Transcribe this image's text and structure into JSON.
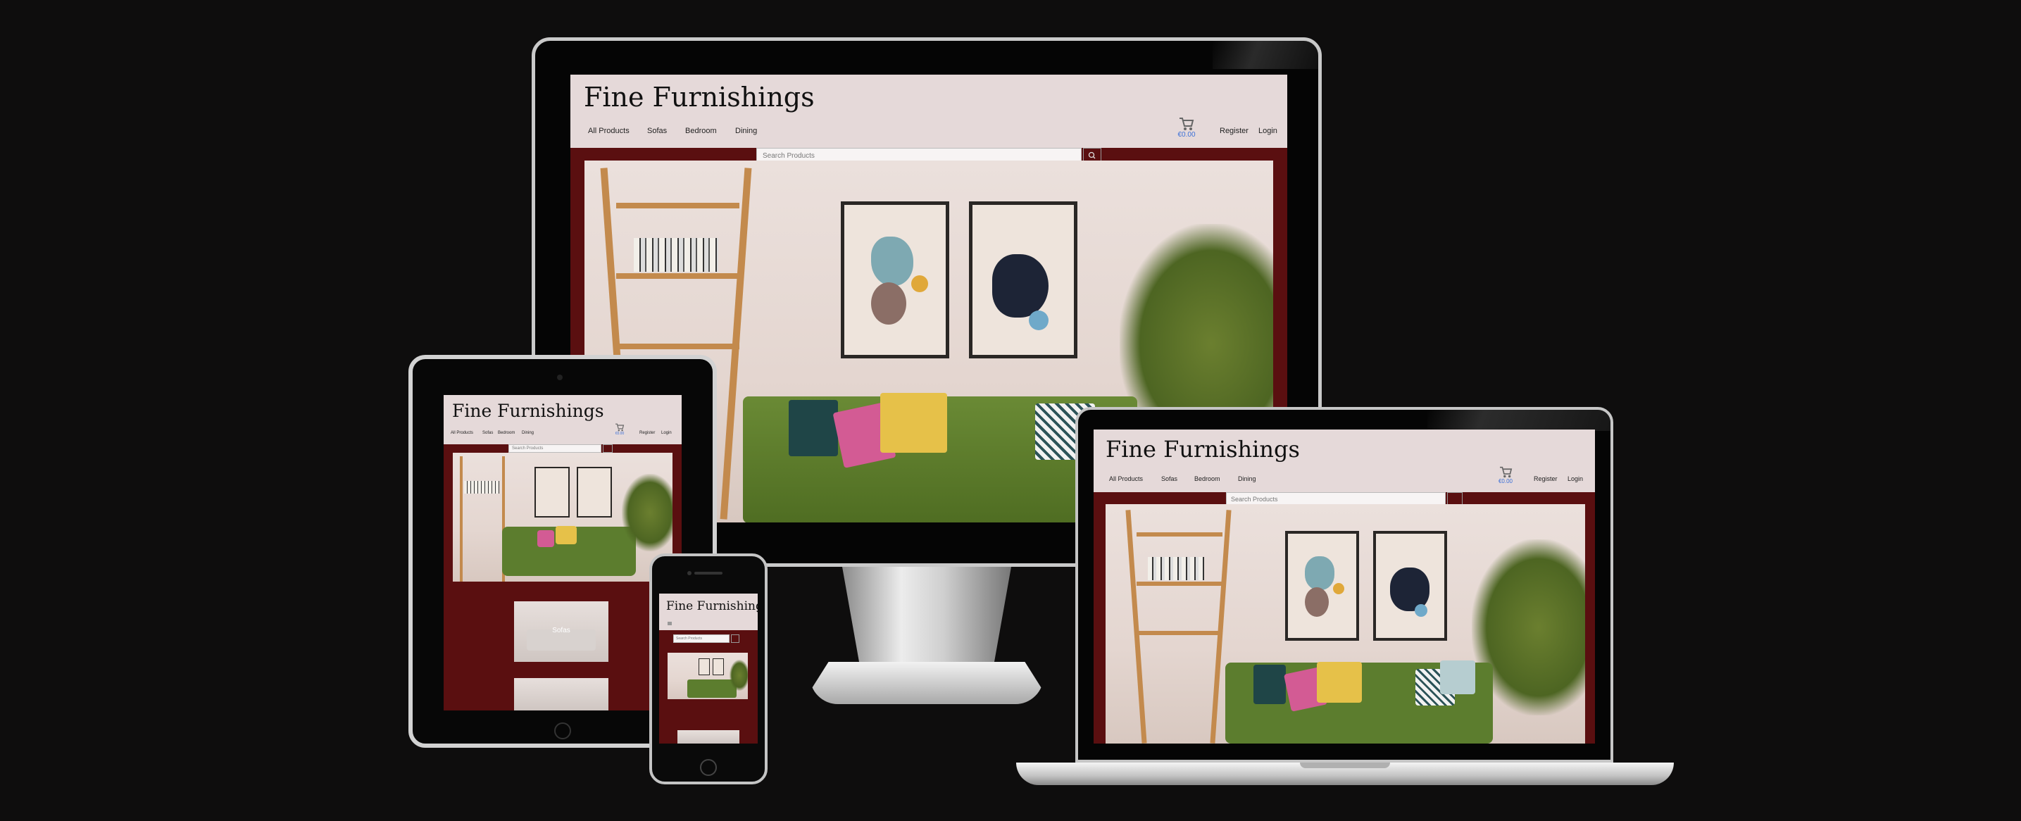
{
  "site": {
    "title": "Fine Furnishings",
    "nav": [
      "All Products",
      "Sofas",
      "Bedroom",
      "Dining"
    ],
    "cart_total": "€0.00",
    "register": "Register",
    "login": "Login",
    "search_placeholder": "Search Products"
  },
  "tablet": {
    "category_tile_label": "Sofas"
  },
  "colors": {
    "page_background": "#0e0d0d",
    "header_background": "#e5d9d9",
    "brand_maroon": "#5a0f10",
    "cart_total_blue": "#3a6fd8"
  },
  "icons": {
    "cart": "cart-icon",
    "search": "search-icon"
  }
}
